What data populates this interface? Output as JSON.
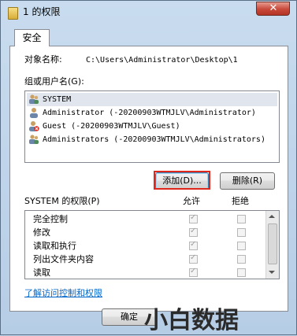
{
  "window": {
    "title": "1 的权限",
    "close_symbol": "✕"
  },
  "tab": {
    "label": "安全"
  },
  "object": {
    "label": "对象名称:",
    "value": "C:\\Users\\Administrator\\Desktop\\1"
  },
  "groups": {
    "label": "组或用户名(G):",
    "items": [
      {
        "name": "SYSTEM",
        "icon": "users-group-icon"
      },
      {
        "name": "Administrator (-20200903WTMJLV\\Administrator)",
        "icon": "user-icon"
      },
      {
        "name": "Guest (-20200903WTMJLV\\Guest)",
        "icon": "user-disabled-icon"
      },
      {
        "name": "Administrators (-20200903WTMJLV\\Administrators)",
        "icon": "users-group-icon"
      }
    ]
  },
  "buttons": {
    "add": "添加(D)...",
    "remove": "删除(R)",
    "ok": "确定"
  },
  "permissions": {
    "header": "SYSTEM 的权限(P)",
    "allow_header": "允许",
    "deny_header": "拒绝",
    "rows": [
      {
        "name": "完全控制",
        "allow": true,
        "deny": false
      },
      {
        "name": "修改",
        "allow": true,
        "deny": false
      },
      {
        "name": "读取和执行",
        "allow": true,
        "deny": false
      },
      {
        "name": "列出文件夹内容",
        "allow": true,
        "deny": false
      },
      {
        "name": "读取",
        "allow": true,
        "deny": false
      }
    ]
  },
  "link": "了解访问控制和权限",
  "watermark": "小白数据"
}
